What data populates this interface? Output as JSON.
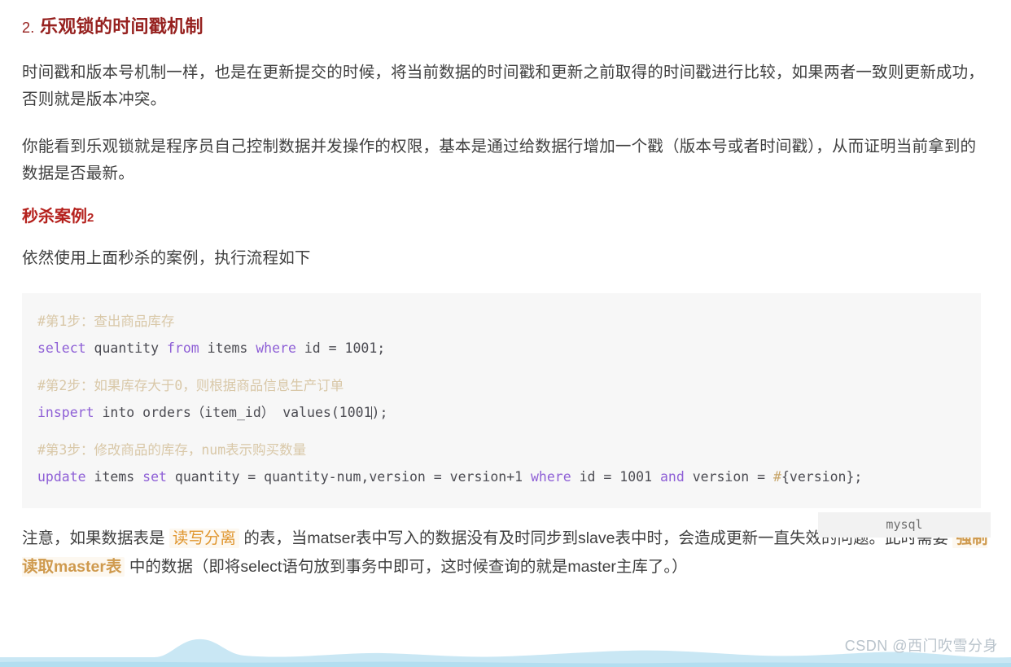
{
  "heading": {
    "number": "2.",
    "title": "乐观锁的时间戳机制"
  },
  "paragraphs": {
    "p1": "时间戳和版本号机制一样，也是在更新提交的时候，将当前数据的时间戳和更新之前取得的时间戳进行比较，如果两者一致则更新成功，否则就是版本冲突。",
    "p2": "你能看到乐观锁就是程序员自己控制数据并发操作的权限，基本是通过给数据行增加一个戳（版本号或者时间戳），从而证明当前拿到的数据是否最新。",
    "p3": "依然使用上面秒杀的案例，执行流程如下"
  },
  "subheading": {
    "text": "秒杀案例",
    "tail": "2"
  },
  "code": {
    "language_label": "mysql",
    "lines": {
      "c1": "#第1步：查出商品库存",
      "s1_kw1": "select",
      "s1_t1": " quantity ",
      "s1_kw2": "from",
      "s1_t2": " items ",
      "s1_kw3": "where",
      "s1_t3": " id = 1001;",
      "c2": "#第2步：如果库存大于0，则根据商品信息生产订单",
      "s2_kw1": "inspert",
      "s2_t1": " into orders（item_id） ",
      "s2_t2": "values(1001",
      "s2_t3": ");",
      "c3": "#第3步：修改商品的库存，num表示购买数量",
      "s3_kw1": "update",
      "s3_t1": " items ",
      "s3_kw2": "set",
      "s3_t2": " quantity = quantity-num,version = version+1 ",
      "s3_kw3": "where",
      "s3_t3": " id = 1001 ",
      "s3_kw4": "and",
      "s3_t4": " version = ",
      "s3_hash": "#",
      "s3_t5": "{version};"
    }
  },
  "note": {
    "seg1": "注意，如果数据表是 ",
    "hl1": "读写分离",
    "seg2": " 的表，当matser表中写入的数据没有及时同步到slave表中时，会造成更新一直失效的问题。此时需要 ",
    "hl2": "强制读取master表",
    "seg3": " 中的数据（即将select语句放到事务中即可，这时候查询的就是master主库了。）"
  },
  "watermark": "CSDN @西门吹雪分身",
  "colors": {
    "heading": "#96211f",
    "subheading": "#b5211d",
    "body_text": "#3f3f3f",
    "code_bg": "#f7f7f7",
    "keyword": "#8e5fd6",
    "comment": "#d9c8a8",
    "highlight_text": "#e0962f",
    "highlight_bg": "#fdf8f0",
    "wave": "#bfe3f2",
    "watermark": "#b9c3cb"
  }
}
